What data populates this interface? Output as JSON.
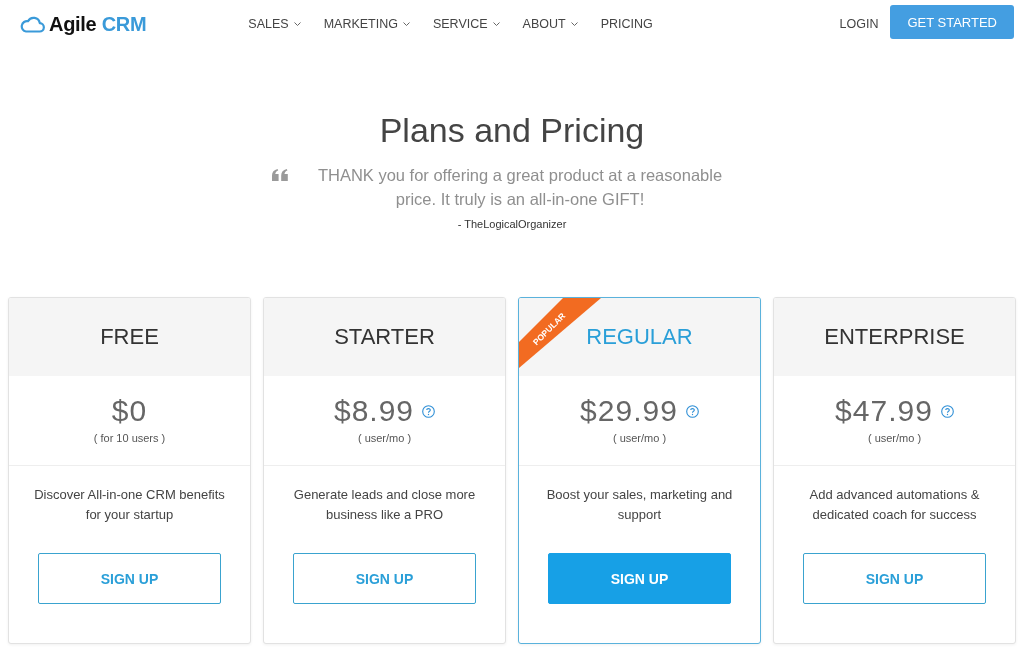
{
  "header": {
    "logo": {
      "name": "Agile",
      "accent": "CRM"
    },
    "nav": [
      {
        "label": "SALES",
        "has_menu": true
      },
      {
        "label": "MARKETING",
        "has_menu": true
      },
      {
        "label": "SERVICE",
        "has_menu": true
      },
      {
        "label": "ABOUT",
        "has_menu": true
      },
      {
        "label": "PRICING",
        "has_menu": false
      }
    ],
    "login": "LOGIN",
    "cta": "GET STARTED"
  },
  "hero": {
    "title": "Plans and Pricing",
    "quote": "THANK you for offering a great product at a reasonable price. It truly is an all-in-one GIFT!",
    "author": "- TheLogicalOrganizer"
  },
  "plans": [
    {
      "name": "FREE",
      "price": "$0",
      "unit": "( for 10 users )",
      "info_icon": false,
      "description": "Discover All-in-one CRM benefits for your startup",
      "button": "SIGN UP",
      "highlighted": false
    },
    {
      "name": "STARTER",
      "price": "$8.99",
      "unit": "( user/mo )",
      "info_icon": true,
      "description": "Generate leads and close more business like a PRO",
      "button": "SIGN UP",
      "highlighted": false
    },
    {
      "name": "REGULAR",
      "price": "$29.99",
      "unit": "( user/mo )",
      "info_icon": true,
      "description": "Boost your sales, marketing and support",
      "button": "SIGN UP",
      "highlighted": true,
      "ribbon": "POPULAR"
    },
    {
      "name": "ENTERPRISE",
      "price": "$47.99",
      "unit": "( user/mo )",
      "info_icon": true,
      "description": "Add advanced automations & dedicated coach for success",
      "button": "SIGN UP",
      "highlighted": false
    }
  ]
}
